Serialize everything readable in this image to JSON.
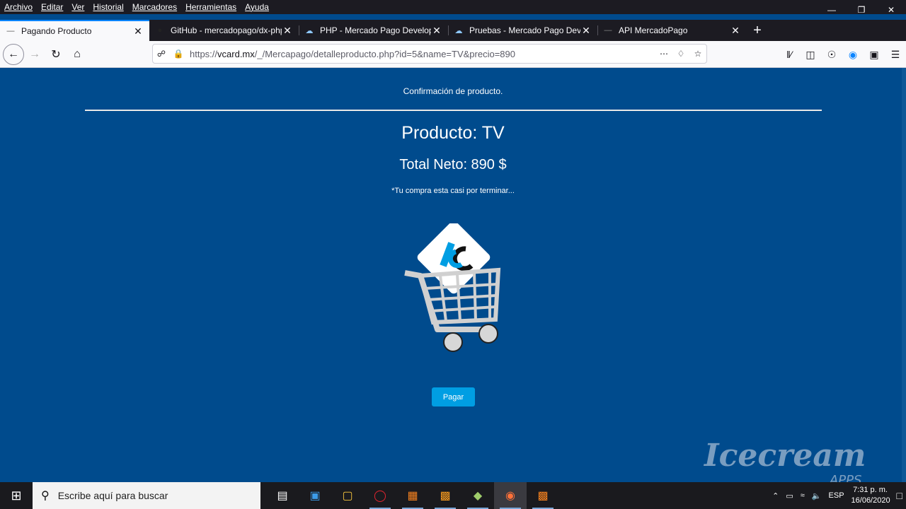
{
  "menubar": {
    "items": [
      "Archivo",
      "Editar",
      "Ver",
      "Historial",
      "Marcadores",
      "Herramientas",
      "Ayuda"
    ]
  },
  "tabs": [
    {
      "label": "Pagando Producto",
      "active": true
    },
    {
      "label": "GitHub - mercadopago/dx-php",
      "active": false
    },
    {
      "label": "PHP - Mercado Pago Develope",
      "active": false
    },
    {
      "label": "Pruebas - Mercado Pago Devel",
      "active": false
    },
    {
      "label": "API MercadoPago",
      "active": false
    }
  ],
  "urlbar": {
    "prefix": "https://",
    "host": "vcard.mx",
    "path": "/_/Mercapago/detalleproducto.php?id=5&name=TV&precio=890"
  },
  "page": {
    "subtitle": "Confirmación de producto.",
    "product": "Producto: TV",
    "total": "Total Neto: 890 $",
    "note": "*Tu compra esta casi por terminar...",
    "pay_label": "Pagar"
  },
  "watermark": {
    "brand": "Icecream",
    "apps": "APPS"
  },
  "taskbar": {
    "search_placeholder": "Escribe aquí para buscar",
    "lang": "ESP",
    "time": "7:31 p. m.",
    "date": "16/06/2020"
  },
  "colors": {
    "page_bg": "#004b8d",
    "pay_button": "#009ee3",
    "tab_accent": "#0a84ff"
  }
}
